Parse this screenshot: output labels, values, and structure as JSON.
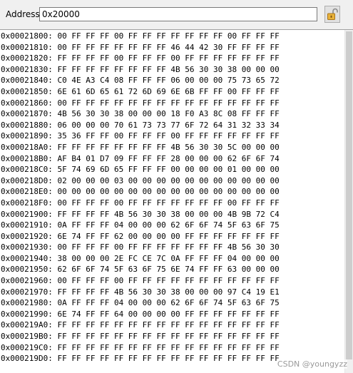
{
  "toolbar": {
    "address_label": "Address:",
    "address_value": "0x20000",
    "lock_icon": "padlock-open-icon"
  },
  "memory": {
    "rows": [
      "0x00021800: 00 FF FF FF 00 FF FF FF FF FF FF FF 00 FF FF FF",
      "0x00021810: 00 FF FF FF FF FF FF FF 46 44 42 30 FF FF FF FF",
      "0x00021820: FF FF FF FF 00 FF FF FF 00 FF FF FF FF FF FF FF",
      "0x00021830: FF FF FF FF FF FF FF FF 4B 56 30 30 38 00 00 00",
      "0x00021840: C0 4E A3 C4 08 FF FF FF 06 00 00 00 75 73 65 72",
      "0x00021850: 6E 61 6D 65 61 72 6D 69 6E 6B FF FF 00 FF FF FF",
      "0x00021860: 00 FF FF FF FF FF FF FF FF FF FF FF FF FF FF FF",
      "0x00021870: 4B 56 30 30 38 00 00 00 18 F0 A3 8C 08 FF FF FF",
      "0x00021880: 06 00 00 00 70 61 73 73 77 6F 72 64 31 32 33 34",
      "0x00021890: 35 36 FF FF 00 FF FF FF 00 FF FF FF FF FF FF FF",
      "0x000218A0: FF FF FF FF FF FF FF FF 4B 56 30 30 5C 00 00 00",
      "0x000218B0: AF B4 01 D7 09 FF FF FF 28 00 00 00 62 6F 6F 74",
      "0x000218C0: 5F 74 69 6D 65 FF FF FF 00 00 00 00 01 00 00 00",
      "0x000218D0: 02 00 00 00 03 00 00 00 00 00 00 00 00 00 00 00",
      "0x000218E0: 00 00 00 00 00 00 00 00 00 00 00 00 00 00 00 00",
      "0x000218F0: 00 FF FF FF 00 FF FF FF FF FF FF FF 00 FF FF FF",
      "0x00021900: FF FF FF FF 4B 56 30 30 38 00 00 00 4B 9B 72 C4",
      "0x00021910: 0A FF FF FF 04 00 00 00 62 6F 6F 74 5F 63 6F 75",
      "0x00021920: 6E 74 FF FF 62 00 00 00 00 FF FF FF FF FF FF FF",
      "0x00021930: 00 FF FF FF 00 FF FF FF FF FF FF FF 4B 56 30 30",
      "0x00021940: 38 00 00 00 2E FC CE 7C 0A FF FF FF 04 00 00 00",
      "0x00021950: 62 6F 6F 74 5F 63 6F 75 6E 74 FF FF 63 00 00 00",
      "0x00021960: 00 FF FF FF 00 FF FF FF FF FF FF FF FF FF FF FF",
      "0x00021970: FF FF FF FF 4B 56 30 30 38 00 00 00 97 C4 19 E1",
      "0x00021980: 0A FF FF FF 04 00 00 00 62 6F 6F 74 5F 63 6F 75",
      "0x00021990: 6E 74 FF FF 64 00 00 00 00 FF FF FF FF FF FF FF",
      "0x000219A0: FF FF FF FF FF FF FF FF FF FF FF FF FF FF FF FF",
      "0x000219B0: FF FF FF FF FF FF FF FF FF FF FF FF FF FF FF FF",
      "0x000219C0: FF FF FF FF FF FF FF FF FF FF FF FF FF FF FF FF",
      "0x000219D0: FF FF FF FF FF FF FF FF FF FF FF FF FF FF FF FF"
    ]
  },
  "watermark": "CSDN @youngyzz"
}
